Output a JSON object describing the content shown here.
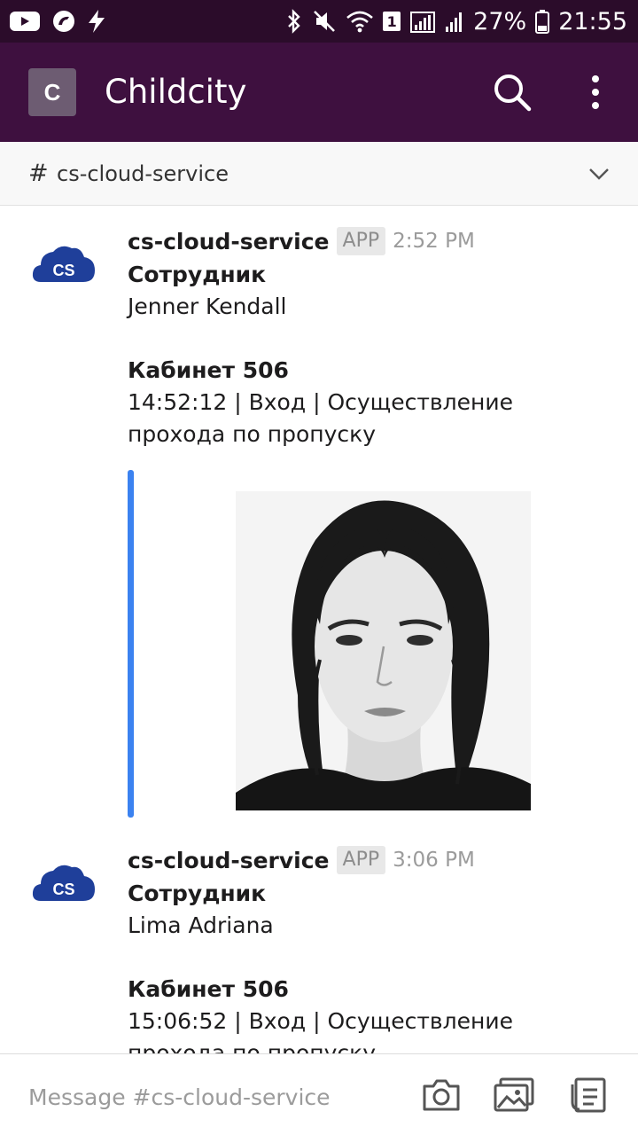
{
  "status_bar": {
    "time": "21:55",
    "battery": "27%",
    "sim_slot": "1",
    "icons": [
      "youtube-icon",
      "app-icon",
      "bolt-icon",
      "bluetooth-icon",
      "mute-icon",
      "wifi-icon",
      "signal-icon",
      "battery-icon"
    ]
  },
  "app_bar": {
    "workspace_initial": "C",
    "workspace_name": "Childcity",
    "accent_color": "#3e103f"
  },
  "channel": {
    "hash": "#",
    "name": "cs-cloud-service"
  },
  "messages": [
    {
      "sender": "cs-cloud-service",
      "badge": "APP",
      "time": "2:52 PM",
      "field1_label": "Сотрудник",
      "field1_value": "Jenner Kendall",
      "field2_label": "Кабинет 506",
      "field2_line1": "14:52:12 | Вход | Осуществление",
      "field2_line2": "прохода по пропуску",
      "has_photo": true
    },
    {
      "sender": "cs-cloud-service",
      "badge": "APP",
      "time": "3:06 PM",
      "field1_label": "Сотрудник",
      "field1_value": "Lima Adriana",
      "field2_label": "Кабинет 506",
      "field2_line1": "15:06:52 | Вход | Осуществление",
      "field2_line2": "прохода по пропуску"
    }
  ],
  "avatar_label": "CS",
  "composer": {
    "placeholder": "Message #cs-cloud-service"
  },
  "colors": {
    "status_bar": "#2b0c2a",
    "app_bar": "#3e103f",
    "attachment_bar": "#3b82f0",
    "avatar_cloud": "#1f3f9a"
  }
}
